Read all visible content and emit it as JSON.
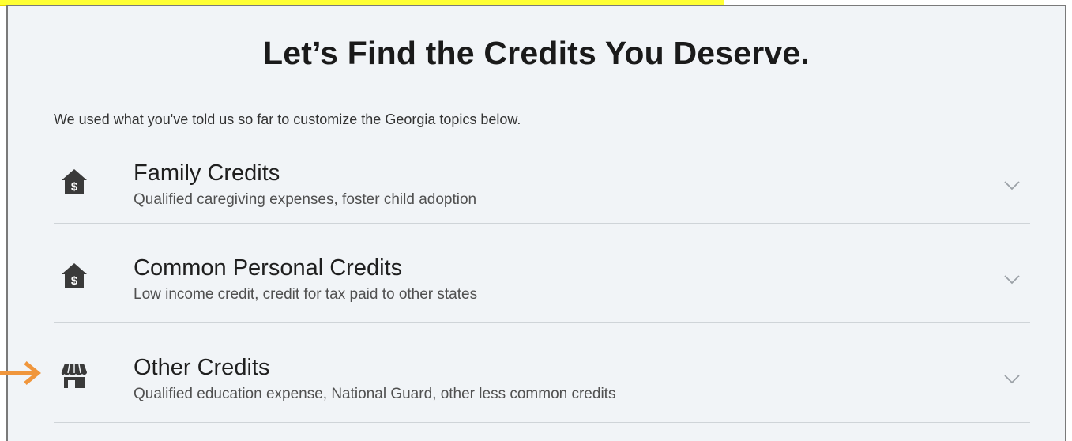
{
  "page": {
    "title": "Let’s Find the Credits You Deserve.",
    "subtitle": "We used what you've told us so far to customize the Georgia topics below."
  },
  "items": [
    {
      "label": "Family Credits",
      "description": "Qualified caregiving expenses, foster child adoption",
      "icon": "house-dollar-icon"
    },
    {
      "label": "Common Personal Credits",
      "description": "Low income credit, credit for tax paid to other states",
      "icon": "house-dollar-icon"
    },
    {
      "label": "Other Credits",
      "description": "Qualified education expense, National Guard, other less common credits",
      "icon": "storefront-icon"
    }
  ],
  "colors": {
    "highlight": "#ffff33",
    "arrow": "#f0963c",
    "panel_bg": "#f1f4f7",
    "icon": "#3a3a3a"
  }
}
